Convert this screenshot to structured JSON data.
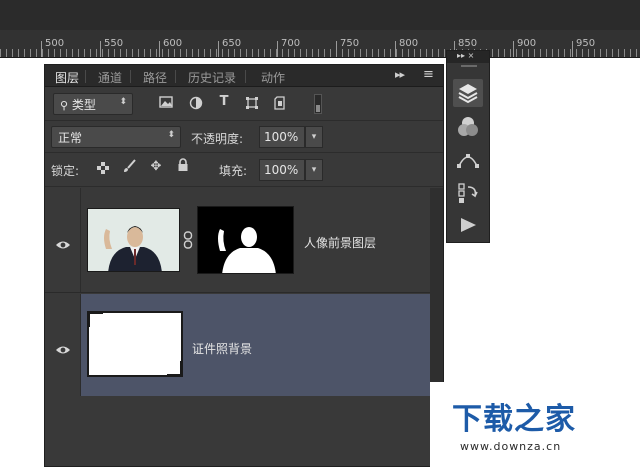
{
  "ruler": {
    "marks": [
      "500",
      "550",
      "600",
      "650",
      "700",
      "750",
      "800",
      "850",
      "900",
      "950"
    ]
  },
  "panel": {
    "tabs": [
      "图层",
      "通道",
      "路径",
      "历史记录",
      "动作"
    ],
    "menu_glyph": "▸▸",
    "menu_glyph2": "≡",
    "filter": {
      "label": "类型",
      "icon": "search-icon"
    },
    "blend_mode": "正常",
    "opacity_label": "不透明度:",
    "opacity_value": "100%",
    "lock_label": "锁定:",
    "fill_label": "填充:",
    "fill_value": "100%",
    "layers": [
      {
        "name": "人像前景图层",
        "selected": false,
        "visible": true
      },
      {
        "name": "证件照背景",
        "selected": true,
        "visible": true
      }
    ]
  },
  "side_panel": {
    "top_glyph": "▸▸ ×",
    "buttons": [
      "layers-icon",
      "channels-icon",
      "paths-icon",
      "history-icon",
      "actions-icon"
    ]
  },
  "watermark": {
    "title": "下载之家",
    "url": "www.downza.cn"
  },
  "colors": {
    "panel_bg": "#393939",
    "selected_layer": "#4d5468",
    "watermark_blue": "#1d5ba8"
  }
}
